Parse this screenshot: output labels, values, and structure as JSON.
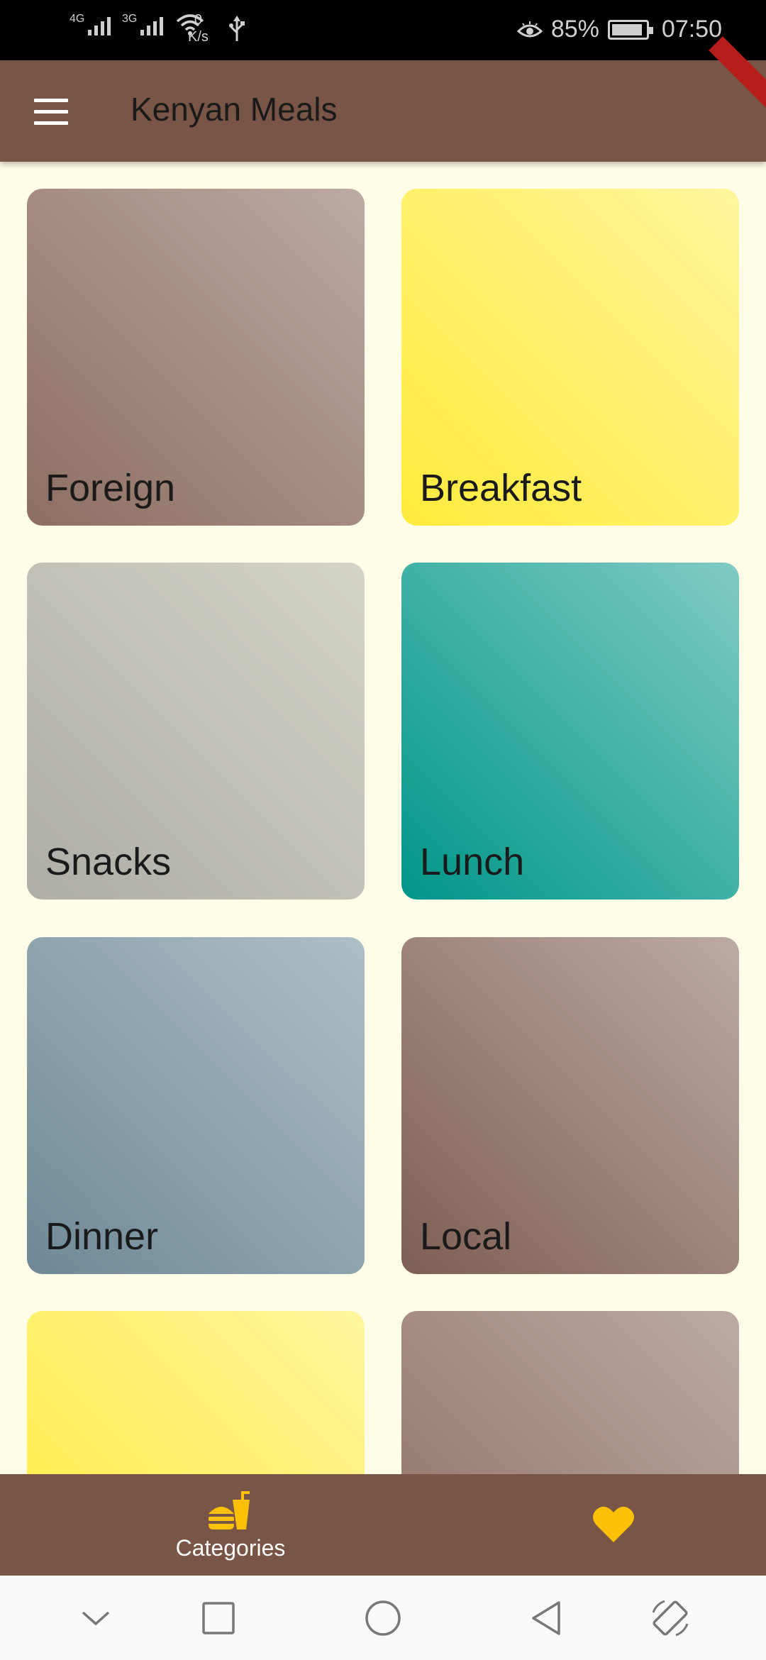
{
  "status_bar": {
    "signal1_tag": "4G",
    "signal2_tag": "3G",
    "speed_value": "0",
    "speed_unit": "K/s",
    "battery_percent": "85%",
    "time": "07:50"
  },
  "app_bar": {
    "title": "Kenyan Meals",
    "menu_icon": "menu-icon"
  },
  "categories": [
    {
      "label": "Foreign",
      "colors": [
        "#8D6E63",
        "#BCAAA4"
      ]
    },
    {
      "label": "Breakfast",
      "colors": [
        "#FFEB3B",
        "#FFF59D"
      ]
    },
    {
      "label": "Snacks",
      "colors": [
        "#AEADA6",
        "#D5D4C8"
      ]
    },
    {
      "label": "Lunch",
      "colors": [
        "#009688",
        "#80CBC4"
      ]
    },
    {
      "label": "Dinner",
      "colors": [
        "#6E8996",
        "#B0BEC5"
      ]
    },
    {
      "label": "Local",
      "colors": [
        "#7E5E54",
        "#BCAAA4"
      ]
    },
    {
      "label": "",
      "colors": [
        "#FFEB3B",
        "#FFF59D"
      ]
    },
    {
      "label": "",
      "colors": [
        "#8D6E63",
        "#BCAAA4"
      ]
    }
  ],
  "bottom_nav": {
    "items": [
      {
        "label": "Categories",
        "icon": "fastfood-icon",
        "selected": true
      },
      {
        "label": "",
        "icon": "heart-icon",
        "selected": false
      }
    ],
    "accent": "#FFC107",
    "background": "#795548"
  },
  "system_nav": {
    "icons": [
      "chevron-down-icon",
      "recents-icon",
      "home-icon",
      "back-icon",
      "rotate-icon"
    ]
  }
}
